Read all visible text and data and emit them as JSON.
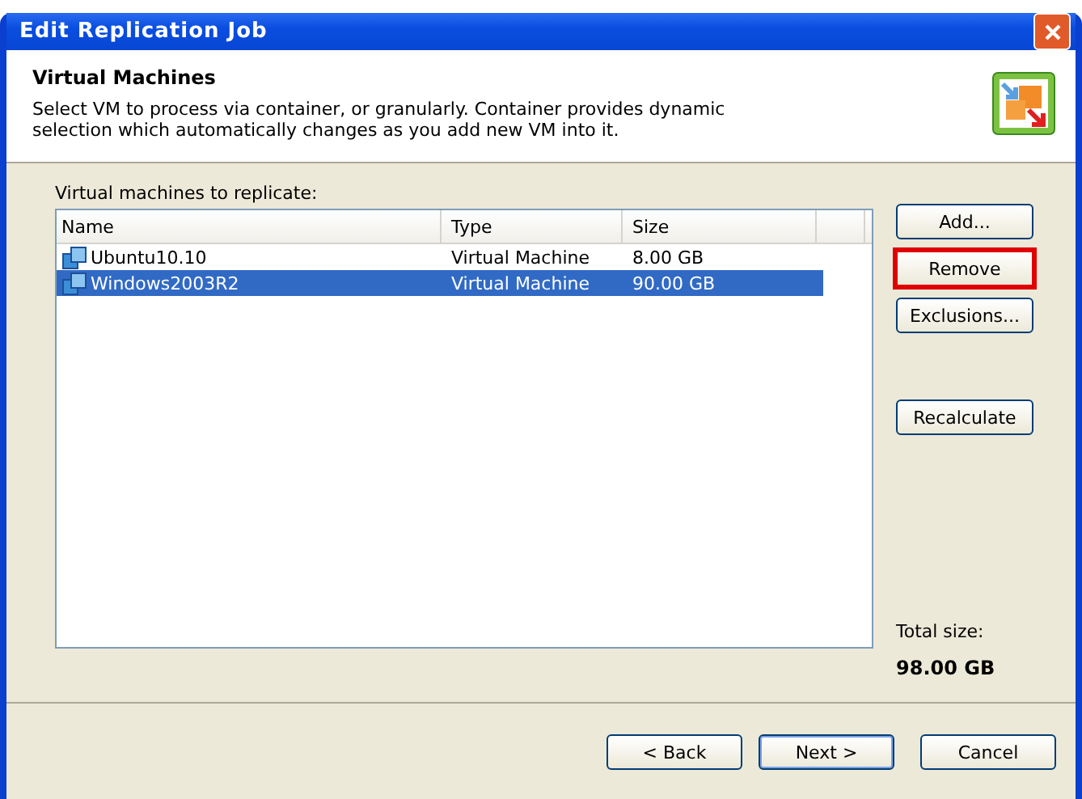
{
  "window": {
    "title": "Edit Replication Job"
  },
  "header": {
    "title": "Virtual Machines",
    "description": "Select VM to process via container, or granularly. Container provides dynamic selection which automatically changes as you add new VM into it."
  },
  "list": {
    "label": "Virtual machines to replicate:",
    "columns": [
      "Name",
      "Type",
      "Size"
    ],
    "rows": [
      {
        "name": "Ubuntu10.10",
        "type": "Virtual Machine",
        "size": "8.00 GB",
        "selected": false
      },
      {
        "name": "Windows2003R2",
        "type": "Virtual Machine",
        "size": "90.00 GB",
        "selected": true
      }
    ]
  },
  "side_buttons": [
    {
      "label": "Add...",
      "highlighted": false
    },
    {
      "label": "Remove",
      "highlighted": true
    },
    {
      "label": "Exclusions...",
      "highlighted": false
    },
    {
      "label": "Recalculate",
      "highlighted": false
    }
  ],
  "total": {
    "label": "Total size:",
    "value": "98.00 GB"
  },
  "buttons": [
    {
      "label": "< Back",
      "default": false
    },
    {
      "label": "Next >",
      "default": true
    },
    {
      "label": "Cancel",
      "default": false
    }
  ]
}
